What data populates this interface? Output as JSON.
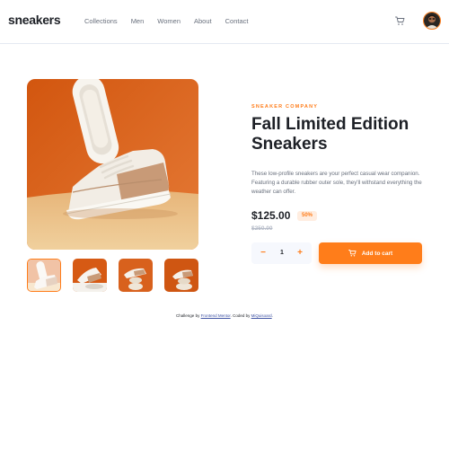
{
  "header": {
    "logo": "sneakers",
    "nav": [
      "Collections",
      "Men",
      "Women",
      "About",
      "Contact"
    ],
    "cart_icon": "cart-icon",
    "avatar_icon": "avatar"
  },
  "gallery": {
    "main_image": "white and tan low-profile sneaker on orange background",
    "thumbnails": [
      "thumbnail-1",
      "thumbnail-2",
      "thumbnail-3",
      "thumbnail-4"
    ],
    "selected_index": 0
  },
  "product": {
    "company": "SNEAKER COMPANY",
    "title": "Fall Limited Edition Sneakers",
    "description": "These low-profile sneakers are your perfect casual wear companion. Featuring a durable rubber outer sole, they'll withstand everything the weather can offer.",
    "price": "$125.00",
    "discount": "50%",
    "old_price": "$250.00"
  },
  "cart_controls": {
    "minus": "−",
    "quantity": "1",
    "plus": "+",
    "add_label": "Add to cart"
  },
  "attribution": {
    "prefix": "Challenge by",
    "fm_link": "Frontend Mentor",
    "middle": ". Coded by",
    "author_link": "MiQuisoard",
    "suffix": "."
  },
  "colors": {
    "accent": "#ff7d1a",
    "accent_pale": "#ffede0",
    "text_dark": "#1d2026",
    "text_grey": "#69707d"
  }
}
